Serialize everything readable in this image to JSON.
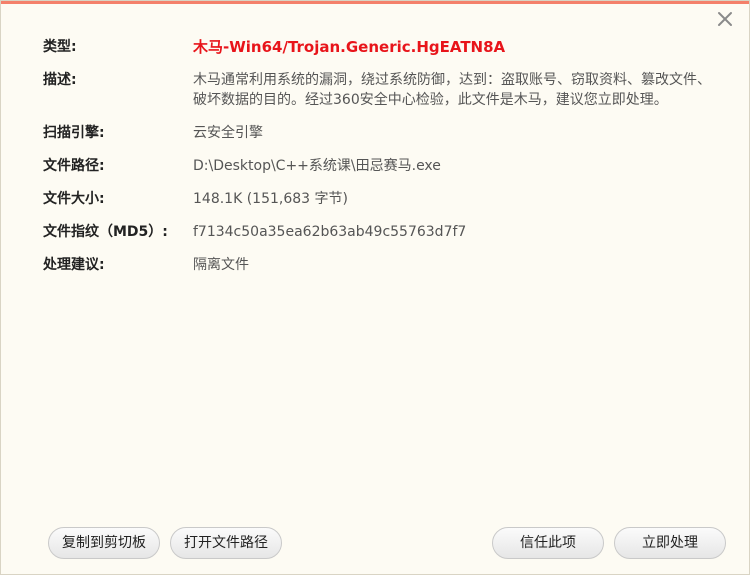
{
  "dialog": {
    "close_icon": "close-icon",
    "accent_color": "#f4806a",
    "threat_color": "#e8141a"
  },
  "details": {
    "type_label": "类型:",
    "type_value": "木马-Win64/Trojan.Generic.HgEATN8A",
    "description_label": "描述:",
    "description_value": "木马通常利用系统的漏洞，绕过系统防御，达到：盗取账号、窃取资料、篡改文件、破坏数据的目的。经过360安全中心检验，此文件是木马，建议您立即处理。",
    "engine_label": "扫描引擎:",
    "engine_value": "云安全引擎",
    "path_label": "文件路径:",
    "path_value": "D:\\Desktop\\C++系统课\\田忌赛马.exe",
    "size_label": "文件大小:",
    "size_value": "148.1K (151,683 字节)",
    "md5_label": "文件指纹（MD5）:",
    "md5_value": "f7134c50a35ea62b63ab49c55763d7f7",
    "advice_label": "处理建议:",
    "advice_value": "隔离文件"
  },
  "buttons": {
    "copy_label": "复制到剪切板",
    "open_path_label": "打开文件路径",
    "trust_label": "信任此项",
    "handle_label": "立即处理"
  }
}
